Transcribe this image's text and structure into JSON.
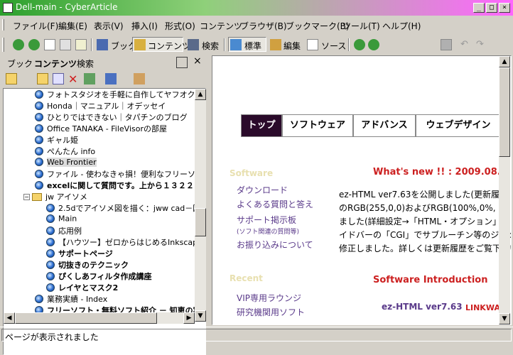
{
  "window": {
    "title": "Dell-main - CyberArticle"
  },
  "menu": [
    "ファイル(F)",
    "編集(E)",
    "表示(V)",
    "挿入(I)",
    "形式(O)",
    "コンテンツ",
    "ブラウザ(B)",
    "ブックマーク(B)",
    "ツール(T)",
    "ヘルプ(H)"
  ],
  "toolbar": {
    "book": "ブック",
    "contents": "コンテンツ",
    "search": "検索",
    "standard": "標準",
    "edit": "編集",
    "source": "ソース"
  },
  "left_tabs": [
    "ブック",
    "コンテンツ",
    "検索"
  ],
  "tree": [
    {
      "label": "フォトスタジオを手軽に自作してヤフオクに挑戦",
      "bold": false
    },
    {
      "label": "Honda｜マニュアル｜オデッセイ",
      "bold": false
    },
    {
      "label": "ひとりではできない｜タパチンのブログ",
      "bold": false
    },
    {
      "label": "Office TANAKA - FileVisorの部屋",
      "bold": false
    },
    {
      "label": "ギャル姫",
      "bold": false
    },
    {
      "label": "ぺんたん info",
      "bold": false
    },
    {
      "label": "Web Frontier",
      "bold": false
    },
    {
      "label": "ファイル - 使わなきゃ損！便利なフリーソフト",
      "bold": false
    },
    {
      "label": "excelに関して質問です。上から１３２２",
      "bold": true
    },
    {
      "label": "jw アイソメ",
      "bold": false,
      "folder": true
    },
    {
      "label": "2.5dでアイソメ図を描く：jww  cad－図",
      "bold": false
    },
    {
      "label": "Main",
      "bold": false
    },
    {
      "label": "応用例",
      "bold": false
    },
    {
      "label": "【ハウツー】ゼロからはじめるInkscape -",
      "bold": false
    },
    {
      "label": "サポートページ",
      "bold": true
    },
    {
      "label": "切抜きのテクニック",
      "bold": true
    },
    {
      "label": "ぴくしあフィルタ作成講座",
      "bold": true
    },
    {
      "label": "レイヤとマスク2",
      "bold": true
    },
    {
      "label": "業務実績 - Index",
      "bold": false
    },
    {
      "label": "フリーソフト・無料ソフト紹介 － 知恵の実",
      "bold": true
    }
  ],
  "web": {
    "nav": [
      "トップ",
      "ソフトウェア",
      "アドバンス",
      "ウェブデザイン"
    ],
    "sidebar_title1": "Software",
    "links": [
      "ダウンロード",
      "よくある質問と答え",
      "サポート掲示板",
      "(ソフト関連の質問等)",
      "お振り込みについて"
    ],
    "whats_new": "What's new !! : 2009.08.",
    "news_lines": [
      "ez-HTML ver7.63を公開しました(更新履",
      "のRGB(255,0,0)およびRGB(100%,0%,",
      "ました(詳細設定→「HTML・オプション」で",
      "イドバーの「CGI」でサブルーチン等のジャン",
      "修正しました。詳しくは更新履歴をご覧下さい"
    ],
    "sidebar_title2": "Recent",
    "links2": [
      "VIP専用ラウンジ",
      "研究機関用ソフト"
    ],
    "sw_intro": "Software Introduction",
    "ezhtml": "ez-HTML ver7.63",
    "linkwa": "LINKWA"
  },
  "status": "ページが表示されました",
  "colors": {
    "nav_active": "#2a0a2a",
    "red": "#cc2020",
    "link": "#5a3a8a"
  }
}
